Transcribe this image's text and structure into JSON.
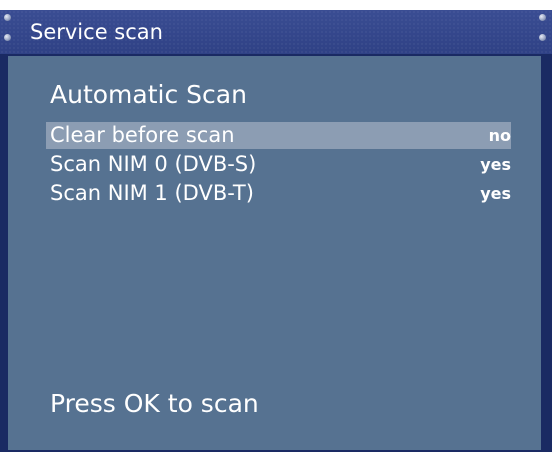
{
  "window": {
    "title": "Service scan"
  },
  "scan": {
    "heading": "Automatic Scan",
    "options": [
      {
        "label": "Clear before scan",
        "value": "no",
        "selected": true
      },
      {
        "label": "Scan NIM 0 (DVB-S)",
        "value": "yes",
        "selected": false
      },
      {
        "label": "Scan NIM 1 (DVB-T)",
        "value": "yes",
        "selected": false
      }
    ],
    "hint": "Press OK to scan"
  },
  "colors": {
    "titlebar": "#33458a",
    "frame": "#1a2a63",
    "panel": "#567291",
    "selection": "#8c9db3",
    "text": "#ffffff"
  },
  "icons": [
    "screw-icon"
  ]
}
